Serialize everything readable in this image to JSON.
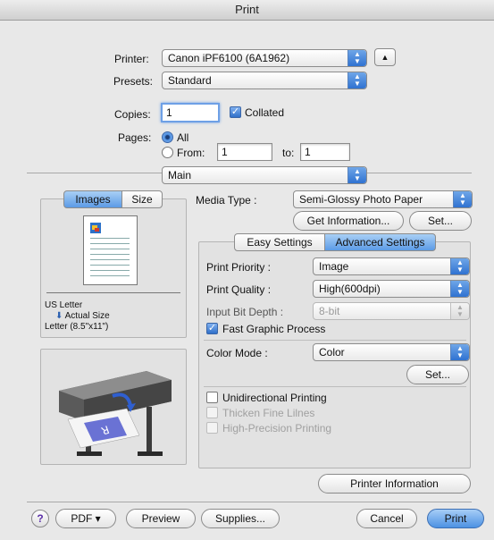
{
  "window": {
    "title": "Print"
  },
  "printer": {
    "label": "Printer:",
    "value": "Canon iPF6100 (6A1962)"
  },
  "presets": {
    "label": "Presets:",
    "value": "Standard"
  },
  "copies": {
    "label": "Copies:",
    "value": "1",
    "collated_label": "Collated",
    "collated": true
  },
  "pages": {
    "label": "Pages:",
    "all_label": "All",
    "from_label": "From:",
    "from_value": "1",
    "to_label": "to:",
    "to_value": "1",
    "selected": "all"
  },
  "section_popup": {
    "value": "Main"
  },
  "preview_tabs": {
    "images": "Images",
    "size": "Size",
    "selected": "Images"
  },
  "paper_info": {
    "line1": "US Letter",
    "line2": "Actual Size",
    "line3": "Letter (8.5\"x11\")"
  },
  "media": {
    "label": "Media Type :",
    "value": "Semi-Glossy Photo Paper",
    "get_info": "Get Information...",
    "set": "Set..."
  },
  "settings_tabs": {
    "easy": "Easy Settings",
    "advanced": "Advanced Settings",
    "selected": "Advanced Settings"
  },
  "advanced": {
    "print_priority": {
      "label": "Print Priority :",
      "value": "Image"
    },
    "print_quality": {
      "label": "Print Quality :",
      "value": "High(600dpi)"
    },
    "input_bit_depth": {
      "label": "Input Bit Depth :",
      "value": "8-bit"
    },
    "fast_graphic": {
      "label": "Fast Graphic Process",
      "checked": true
    },
    "color_mode": {
      "label": "Color Mode :",
      "value": "Color",
      "set": "Set..."
    },
    "unidirectional": {
      "label": "Unidirectional Printing",
      "checked": false
    },
    "thicken": {
      "label": "Thicken Fine Lilnes",
      "checked": false
    },
    "high_precision": {
      "label": "High-Precision Printing",
      "checked": false
    }
  },
  "printer_info_button": "Printer Information",
  "footer": {
    "help": "?",
    "pdf": "PDF ▾",
    "preview": "Preview",
    "supplies": "Supplies...",
    "cancel": "Cancel",
    "print": "Print"
  },
  "colors": {
    "accent": "#4d92e3",
    "window_bg": "#e8e8e8"
  }
}
